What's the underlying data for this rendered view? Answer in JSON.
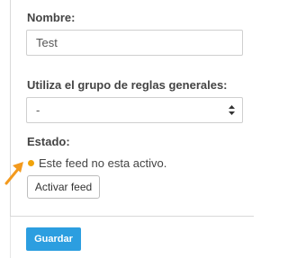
{
  "form": {
    "nombre_label": "Nombre:",
    "nombre_value": "Test",
    "reglas_label": "Utiliza el grupo de reglas generales:",
    "reglas_selected": "-",
    "estado_label": "Estado:",
    "estado_text": "Este feed no esta activo.",
    "activar_button": "Activar feed",
    "guardar_button": "Guardar"
  },
  "colors": {
    "status_dot": "#f0a30a",
    "primary_button": "#2c9ee0",
    "annotation_arrow": "#f39a1e"
  },
  "icons": {
    "status": "status-dot-icon",
    "select": "select-arrows-icon",
    "annotation": "annotation-arrow-icon"
  }
}
